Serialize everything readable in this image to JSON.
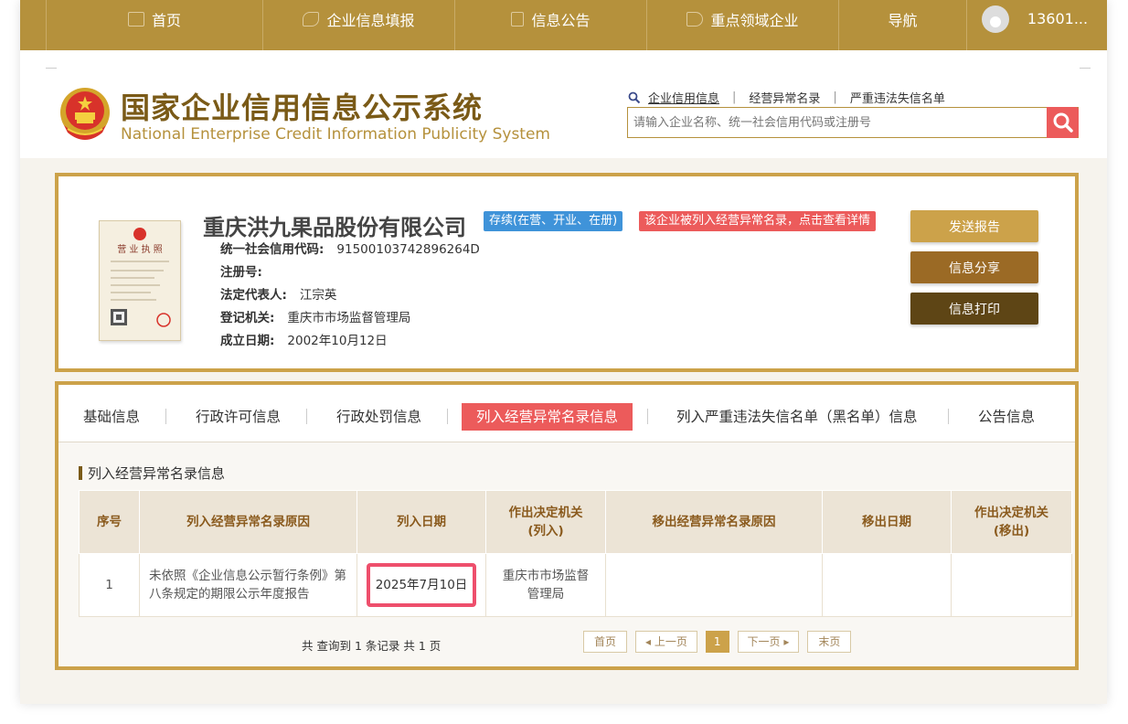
{
  "nav": {
    "items": [
      "首页",
      "企业信息填报",
      "信息公告",
      "重点领域企业",
      "导航"
    ],
    "user": "13601..."
  },
  "header": {
    "title_cn": "国家企业信用信息公示系统",
    "title_en": "National Enterprise Credit Information Publicity System",
    "links": [
      "企业信用信息",
      "经营异常名录",
      "严重违法失信名单"
    ],
    "search_placeholder": "请输入企业名称、统一社会信用代码或注册号"
  },
  "company": {
    "name": "重庆洪九果品股份有限公司",
    "status_tag": "存续(在营、开业、在册)",
    "alert_tag": "该企业被列入经营异常名录，点击查看详情",
    "license_title": "营业执照",
    "fields": [
      {
        "label": "统一社会信用代码:",
        "value": "91500103742896264D"
      },
      {
        "label": "注册号:",
        "value": ""
      },
      {
        "label": "法定代表人:",
        "value": "江宗英"
      },
      {
        "label": "登记机关:",
        "value": "重庆市市场监督管理局"
      },
      {
        "label": "成立日期:",
        "value": "2002年10月12日"
      }
    ],
    "actions": [
      "发送报告",
      "信息分享",
      "信息打印"
    ]
  },
  "tabs": [
    "基础信息",
    "行政许可信息",
    "行政处罚信息",
    "列入经营异常名录信息",
    "列入严重违法失信名单（黑名单）信息",
    "公告信息"
  ],
  "section": {
    "title": "列入经营异常名录信息",
    "columns": [
      "序号",
      "列入经营异常名录原因",
      "列入日期",
      "作出决定机关\n(列入)",
      "移出经营异常名录原因",
      "移出日期",
      "作出决定机关\n(移出)"
    ],
    "rows": [
      [
        "1",
        "未依照《企业信息公示暂行条例》第八条规定的期限公示年度报告",
        "2025年7月10日",
        "重庆市市场监督管理局",
        "",
        "",
        ""
      ]
    ]
  },
  "pager": {
    "total_text": "共 查询到 1 条记录 共 1 页",
    "first": "首页",
    "prev": "上一页",
    "current": "1",
    "next": "下一页",
    "last": "末页"
  },
  "colors": {
    "gold": "#b5913c",
    "brown": "#7a5a17",
    "red": "#ec5b5b",
    "blue": "#3f93d9"
  }
}
